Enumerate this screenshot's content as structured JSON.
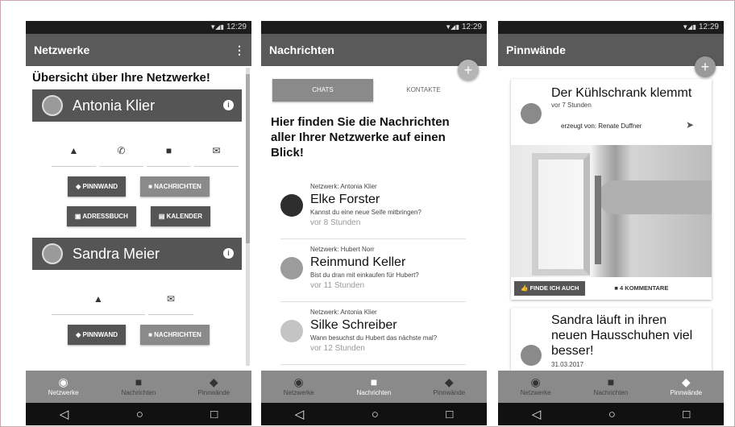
{
  "status": {
    "time": "12:29"
  },
  "phone1": {
    "title": "Netzwerke",
    "heading": "Übersicht über Ihre Netzwerke!",
    "contacts": [
      {
        "name": "Antonia Klier",
        "buttons": [
          "PINNWAND",
          "NACHRICHTEN",
          "ADRESSBUCH",
          "KALENDER"
        ]
      },
      {
        "name": "Sandra Meier",
        "buttons": [
          "PINNWAND",
          "NACHRICHTEN"
        ]
      }
    ]
  },
  "phone2": {
    "title": "Nachrichten",
    "tabs": [
      "CHATS",
      "KONTAKTE"
    ],
    "intro": "Hier finden Sie die Nachrichten aller Ihrer Netzwerke auf einen Blick!",
    "messages": [
      {
        "network": "Netzwerk: Antonia Klier",
        "name": "Elke Forster",
        "text": "Kannst du eine neue Seife mitbringen?",
        "time": "vor 8 Stunden"
      },
      {
        "network": "Netzwerk: Hubert Norr",
        "name": "Reinmund Keller",
        "text": "Bist du dran mit einkaufen für Hubert?",
        "time": "vor 11 Stunden"
      },
      {
        "network": "Netzwerk: Antonia Klier",
        "name": "Silke Schreiber",
        "text": "Wann besuchst du Hubert das nächste mal?",
        "time": "vor 12 Stunden"
      }
    ]
  },
  "phone3": {
    "title": "Pinnwände",
    "post1": {
      "title": "Der Kühlschrank klemmt",
      "time": "vor 7 Stunden",
      "by": "erzeugt von: Renate Duffner",
      "like": "FINDE ICH AUCH",
      "comments": "4 KOMMENTARE"
    },
    "post2": {
      "title": "Sandra läuft in ihren neuen Hausschuhen viel besser!",
      "date": "31.03.2017"
    }
  },
  "nav": {
    "n1": "Netzwerke",
    "n2": "Nachrichten",
    "n3": "Pinnwände"
  }
}
